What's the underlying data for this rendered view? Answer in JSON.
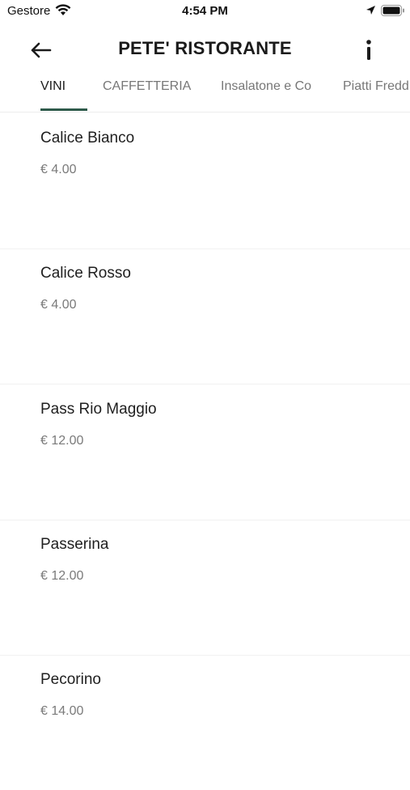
{
  "status": {
    "carrier": "Gestore",
    "time": "4:54 PM"
  },
  "header": {
    "title": "PETE' RISTORANTE",
    "back_icon": "arrow-left-icon",
    "info_icon": "info-icon"
  },
  "tabs": [
    {
      "label": "VINI",
      "active": true
    },
    {
      "label": "CAFFETTERIA",
      "active": false
    },
    {
      "label": "Insalatone e Co",
      "active": false
    },
    {
      "label": "Piatti Freddi",
      "active": false
    }
  ],
  "colors": {
    "accent": "#2e5a4a",
    "text": "#1f1f1f",
    "muted": "#7a7a7a"
  },
  "items": [
    {
      "name": "Calice Bianco",
      "price": "€ 4.00"
    },
    {
      "name": "Calice Rosso",
      "price": "€ 4.00"
    },
    {
      "name": "Pass Rio Maggio",
      "price": "€ 12.00"
    },
    {
      "name": "Passerina",
      "price": "€ 12.00"
    },
    {
      "name": "Pecorino",
      "price": "€ 14.00"
    }
  ]
}
